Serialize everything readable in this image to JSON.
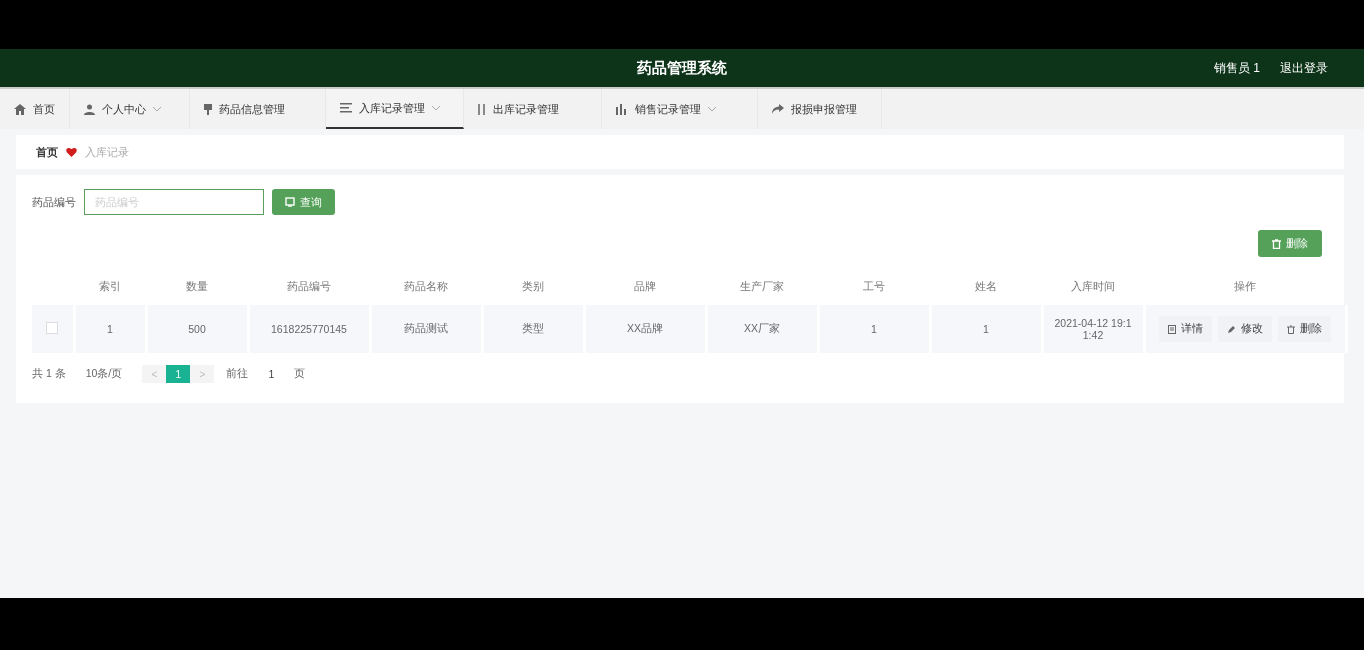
{
  "header": {
    "title": "药品管理系统",
    "user": "销售员 1",
    "logout": "退出登录"
  },
  "nav": [
    {
      "label": "首页",
      "dropdown": false,
      "selected": false
    },
    {
      "label": "个人中心",
      "dropdown": true,
      "selected": false
    },
    {
      "label": "药品信息管理",
      "dropdown": false,
      "selected": false
    },
    {
      "label": "入库记录管理",
      "dropdown": true,
      "selected": true
    },
    {
      "label": "出库记录管理",
      "dropdown": false,
      "selected": false
    },
    {
      "label": "销售记录管理",
      "dropdown": true,
      "selected": false
    },
    {
      "label": "报损申报管理",
      "dropdown": false,
      "selected": false
    }
  ],
  "breadcrumb": [
    "首页",
    "入库记录"
  ],
  "search": {
    "label": "药品编号",
    "placeholder": "药品编号",
    "button": "查询"
  },
  "delete_button": "删除",
  "table": {
    "columns": [
      "索引",
      "数量",
      "药品编号",
      "药品名称",
      "类别",
      "品牌",
      "生产厂家",
      "工号",
      "姓名",
      "入库时间",
      "操作"
    ],
    "rows": [
      {
        "checked": false,
        "cells": [
          "1",
          "500",
          "1618225770145",
          "药品测试",
          "类型",
          "XX品牌",
          "XX厂家",
          "1",
          "1",
          "2021-04-12 19:11:42"
        ],
        "actions": [
          {
            "kind": "detail",
            "label": "详情"
          },
          {
            "kind": "edit",
            "label": "修改"
          },
          {
            "kind": "delete",
            "label": "删除"
          }
        ]
      }
    ]
  },
  "pagination": {
    "total": "共 1 条",
    "page_size": "10条/页",
    "prev": "<",
    "pages": [
      {
        "label": "1",
        "selected": true
      }
    ],
    "next": ">",
    "goto": "前往",
    "goto_value": "1",
    "goto_unit": "页"
  }
}
